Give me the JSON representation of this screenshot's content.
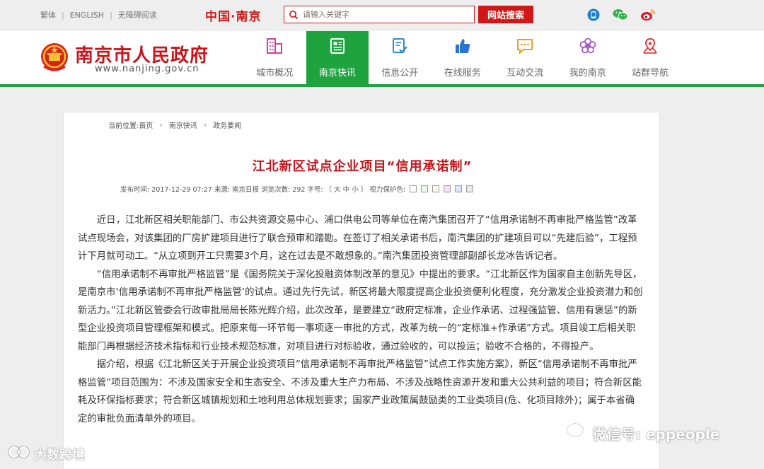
{
  "topbar": {
    "links": [
      "繁体",
      "ENGLISH",
      "无障碍阅读"
    ],
    "china_logo": "中国·南京",
    "search_placeholder": "请输入关键字",
    "search_button": "网站搜索",
    "social_icons": [
      "app-icon",
      "wechat-icon",
      "weibo-icon"
    ]
  },
  "header": {
    "site_name": "南京市人民政府",
    "site_url": "www.nanjing.gov.cn",
    "nav": [
      {
        "label": "城市概况",
        "icon": "building-icon",
        "active": false
      },
      {
        "label": "南京快讯",
        "icon": "newspaper-icon",
        "active": true
      },
      {
        "label": "信息公开",
        "icon": "document-check-icon",
        "active": false
      },
      {
        "label": "在线服务",
        "icon": "thumbs-up-icon",
        "active": false
      },
      {
        "label": "互动交流",
        "icon": "chat-icon",
        "active": false
      },
      {
        "label": "我的南京",
        "icon": "flower-icon",
        "active": false
      },
      {
        "label": "站群导航",
        "icon": "location-icon",
        "active": false
      }
    ]
  },
  "breadcrumb": {
    "prefix": "当前位置:首页",
    "items": [
      "南京快讯",
      "政务要闻"
    ]
  },
  "article": {
    "title": "江北新区试点企业项目“信用承诺制”",
    "meta": {
      "publish": "发布时间: 2017-12-29 07:27",
      "source": "来源: 南京日报",
      "views": "浏览次数: 292",
      "fontsize": "字号: 〔 大 中 小 〕",
      "eye": "视力保护色:"
    },
    "swatches": [
      "#ffffff",
      "#eef8ee",
      "#fbfbe2",
      "#f7dff2",
      "#dce8f8",
      "#e8e8e8"
    ],
    "paragraphs": [
      "近日，江北新区相关职能部门、市公共资源交易中心、浦口供电公司等单位在南汽集团召开了“信用承诺制不再审批严格监管”改革试点现场会，对该集团的厂房扩建项目进行了联合预审和踏勘。在签订了相关承诺书后，南汽集团的扩建项目可以“先建后验”，工程预计下月就可动工。“从立项到开工只需要3个月，这在过去是不敢想象的。”南汽集团投资管理部副部长龙冰告诉记者。",
      "“信用承诺制不再审批严格监管”是《国务院关于深化投融资体制改革的意见》中提出的要求。“江北新区作为国家自主创新先导区，是南京市‘信用承诺制不再审批严格监管’的试点。通过先行先试，新区将最大限度提高企业投资便利化程度，充分激发企业投资潜力和创新活力。”江北新区管委会行政审批局局长陈光辉介绍，此次改革，是要建立“政府定标准，企业作承诺、过程强监管、信用有褒惩”的新型企业投资项目管理框架和模式。把原来每一环节每一事项逐一审批的方式，改革为统一的“定标准+作承诺”方式。项目竣工后相关职能部门再根据经济技术指标和行业技术规范标准，对项目进行对标验收，通过验收的，可以投运；验收不合格的，不得投产。",
      "据介绍，根据《江北新区关于开展企业投资项目“信用承诺制不再审批严格监管”试点工作实施方案》，新区“信用承诺制不再审批严格监管”项目范围为：不涉及国家安全和生态安全、不涉及重大生产力布局、不涉及战略性资源开发和重大公共利益的项目；符合新区能耗及环保指标要求；符合新区城镇规划和土地利用总体规划要求；国家产业政策属鼓励类的工业类项目(危、化项目除外)；属于本省确定的审批负面清单外的项目。"
    ]
  },
  "watermarks": {
    "left": "大数跨境",
    "right": "微信号: eppeople"
  },
  "colors": {
    "brand_red": "#c4161c",
    "nav_green": "#1fa33f"
  }
}
